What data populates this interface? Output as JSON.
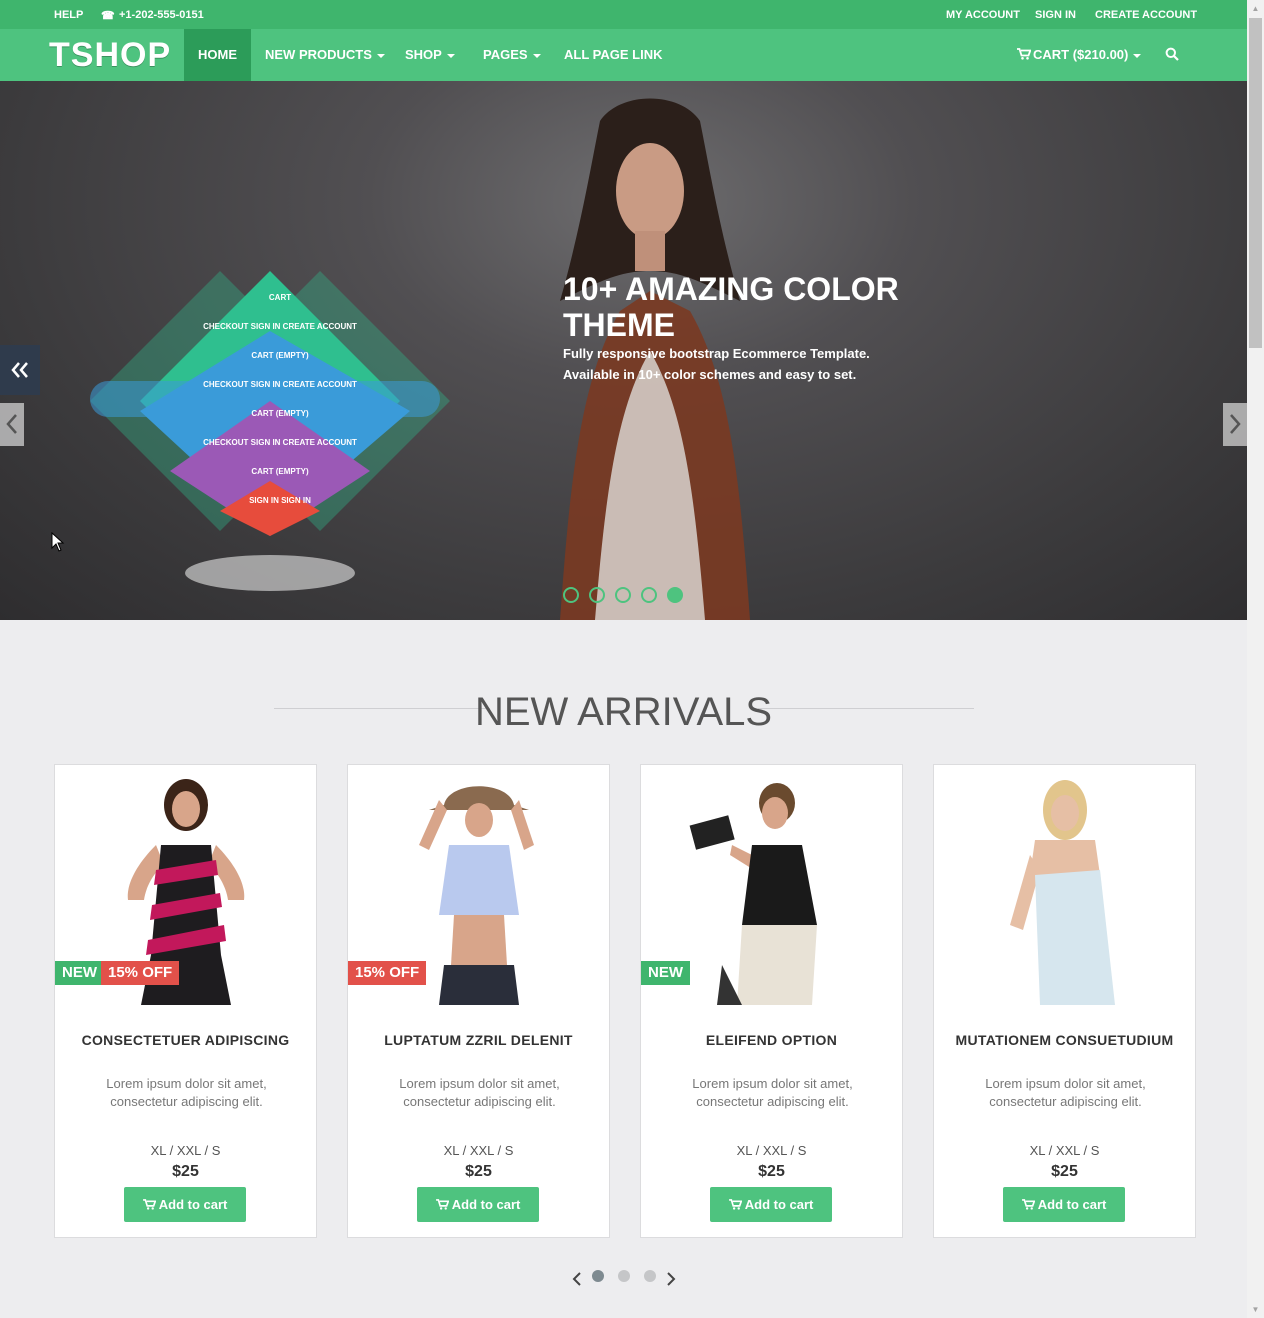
{
  "topbar": {
    "help": "HELP",
    "phone": "+1-202-555-0151",
    "my_account": "MY ACCOUNT",
    "sign_in": "SIGN IN",
    "create_account": "CREATE ACCOUNT"
  },
  "nav": {
    "logo": "TSHOP",
    "home": "HOME",
    "new_products": "NEW PRODUCTS",
    "shop": "SHOP",
    "pages": "PAGES",
    "all_page_link": "ALL PAGE LINK",
    "cart": "CART ($210.00)"
  },
  "hero": {
    "title": "10+ AMAZING COLOR THEME",
    "subtitle_line1": "Fully responsive bootstrap Ecommerce Template.",
    "subtitle_line2": "Available in 10+ color schemes and easy to set.",
    "slide_count": 5,
    "active_slide": 5,
    "menu_demo": {
      "row1": "CART",
      "row2": "CHECKOUT   SIGN IN   CREATE ACCOUNT",
      "row3": "CART (EMPTY)",
      "row4": "CHECKOUT   SIGN IN   CREATE ACCOUNT",
      "row5": "CART (EMPTY)",
      "row6": "CHECKOUT   SIGN IN   CREATE ACCOUNT",
      "row7": "CART (EMPTY)",
      "row8": "SIGN IN   SIGN IN",
      "colors": [
        "#2fbf8f",
        "#3a9bd9",
        "#9b59b6",
        "#e74c3c"
      ]
    }
  },
  "section": {
    "title": "NEW ARRIVALS"
  },
  "products": [
    {
      "name": "CONSECTETUER ADIPISCING",
      "desc": "Lorem ipsum dolor sit amet, consectetur adipiscing elit.",
      "sizes": "XL / XXL / S",
      "price": "$25",
      "button": "Add to cart",
      "badge_new": "NEW",
      "badge_off": "15% OFF"
    },
    {
      "name": "LUPTATUM ZZRIL DELENIT",
      "desc": "Lorem ipsum dolor sit amet, consectetur adipiscing elit.",
      "sizes": "XL / XXL / S",
      "price": "$25",
      "button": "Add to cart",
      "badge_off": "15% OFF"
    },
    {
      "name": "ELEIFEND OPTION",
      "desc": "Lorem ipsum dolor sit amet, consectetur adipiscing elit.",
      "sizes": "XL / XXL / S",
      "price": "$25",
      "button": "Add to cart",
      "badge_new": "NEW"
    },
    {
      "name": "MUTATIONEM CONSUETUDIUM",
      "desc": "Lorem ipsum dolor sit amet, consectetur adipiscing elit.",
      "sizes": "XL / XXL / S",
      "price": "$25",
      "button": "Add to cart"
    }
  ],
  "carousel": {
    "page_count": 3,
    "active_page": 1
  },
  "colors": {
    "brand_green": "#4ec37f",
    "topbar_green": "#3fb56d",
    "active_nav": "#2c9c59",
    "sale_red": "#e2514a"
  }
}
